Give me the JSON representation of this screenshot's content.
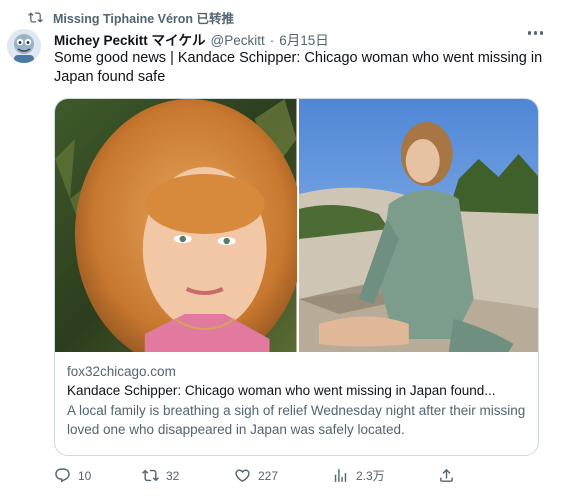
{
  "retweet": {
    "text": "Missing Tiphaine Véron 已转推"
  },
  "author": {
    "display_name": "Michey Peckitt マイケル",
    "handle": "@Peckitt",
    "separator": "·",
    "date": "6月15日"
  },
  "tweet": {
    "text": "Some good news | Kandace Schipper: Chicago woman who went missing in Japan found safe"
  },
  "card": {
    "domain": "fox32chicago.com",
    "title": "Kandace Schipper: Chicago woman who went missing in Japan found...",
    "description": "A local family is breathing a sigh of relief Wednesday night after their missing loved one who disappeared in Japan was safely located."
  },
  "actions": {
    "replies": "10",
    "retweets": "32",
    "likes": "227",
    "views": "2.3万"
  },
  "colors": {
    "text": "#0f1419",
    "secondary": "#536471",
    "border": "#cfd9de"
  },
  "icons": [
    "retweet-icon",
    "more-icon",
    "reply-icon",
    "retweet-icon",
    "like-icon",
    "views-icon",
    "share-icon"
  ]
}
